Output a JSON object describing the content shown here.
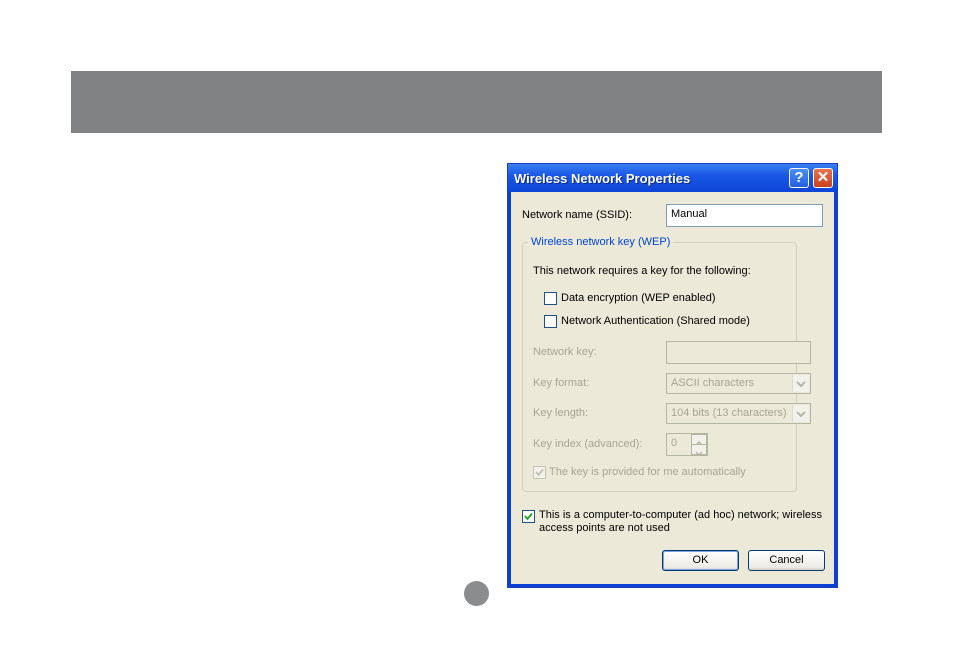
{
  "dialog": {
    "title": "Wireless Network Properties",
    "help_glyph": "?",
    "close_glyph": "✕",
    "ssid_label": "Network name (SSID):",
    "ssid_value": "Manual",
    "group_title": "Wireless network key (WEP)",
    "requires_text": "This network requires a key for the following:",
    "data_encryption_label": "Data encryption (WEP enabled)",
    "data_encryption_checked": false,
    "network_auth_label": "Network Authentication (Shared mode)",
    "network_auth_checked": false,
    "network_key_label": "Network key:",
    "network_key_value": "",
    "key_format_label": "Key format:",
    "key_format_value": "ASCII characters",
    "key_length_label": "Key length:",
    "key_length_value": "104 bits (13 characters)",
    "key_index_label": "Key index (advanced):",
    "key_index_value": "0",
    "auto_key_label": "The key is provided for me automatically",
    "auto_key_checked": true,
    "adhoc_label_line1": "This is a computer-to-computer (ad hoc) network; wireless",
    "adhoc_label_line2": "access points are not used",
    "adhoc_checked": true,
    "ok_label": "OK",
    "cancel_label": "Cancel"
  },
  "colors": {
    "header_bar": "#808284",
    "titlebar_blue": "#0b45d8",
    "dialog_face": "#ece9d8",
    "group_title": "#0046d5",
    "check_green": "#21a121"
  },
  "icons": {
    "help": "help-icon",
    "close": "close-icon",
    "spin_up": "spin-up-icon",
    "spin_down": "spin-down-icon",
    "dropdown": "chevron-down-icon",
    "check": "checkmark-icon"
  }
}
